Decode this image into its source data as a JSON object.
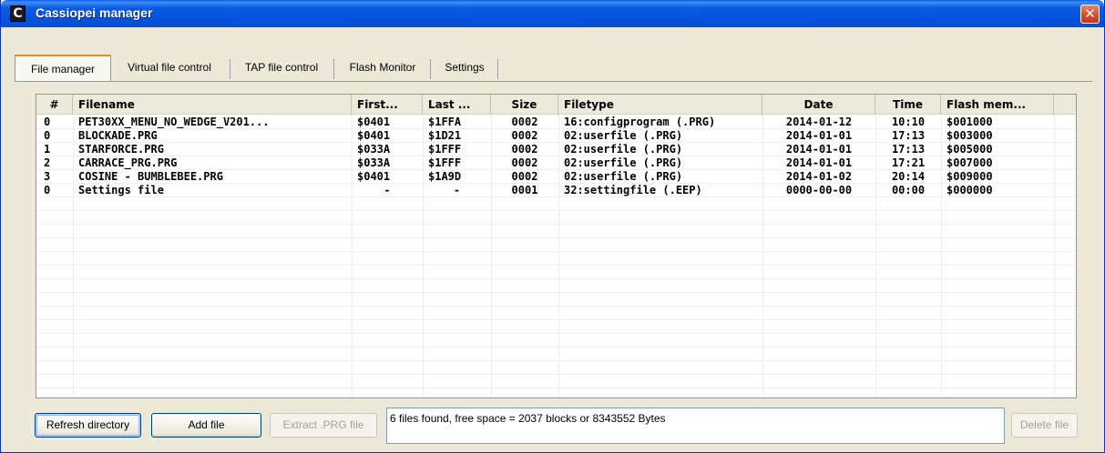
{
  "window": {
    "title": "Cassiopei manager",
    "icon_glyph": "C"
  },
  "tabs": [
    {
      "label": "File manager",
      "active": true
    },
    {
      "label": "Virtual file control",
      "active": false
    },
    {
      "label": "TAP file control",
      "active": false
    },
    {
      "label": "Flash Monitor",
      "active": false
    },
    {
      "label": "Settings",
      "active": false
    }
  ],
  "table": {
    "columns": [
      "#",
      "Filename",
      "First...",
      "Last ...",
      "Size",
      "Filetype",
      "Date",
      "Time",
      "Flash mem..."
    ],
    "rows": [
      [
        "0",
        "PET30XX_MENU_NO_WEDGE_V201...",
        "$0401",
        "$1FFA",
        "0002",
        "16:configprogram (.PRG)",
        "2014-01-12",
        "10:10",
        "$001000"
      ],
      [
        "0",
        "BLOCKADE.PRG",
        "$0401",
        "$1D21",
        "0002",
        "02:userfile (.PRG)",
        "2014-01-01",
        "17:13",
        "$003000"
      ],
      [
        "1",
        "STARFORCE.PRG",
        "$033A",
        "$1FFF",
        "0002",
        "02:userfile (.PRG)",
        "2014-01-01",
        "17:13",
        "$005000"
      ],
      [
        "2",
        "CARRACE_PRG.PRG",
        "$033A",
        "$1FFF",
        "0002",
        "02:userfile (.PRG)",
        "2014-01-01",
        "17:21",
        "$007000"
      ],
      [
        "3",
        "COSINE - BUMBLEBEE.PRG",
        "$0401",
        "$1A9D",
        "0002",
        "02:userfile (.PRG)",
        "2014-01-02",
        "20:14",
        "$009000"
      ],
      [
        "0",
        "Settings file",
        "-",
        "-",
        "0001",
        "32:settingfile (.EEP)",
        "0000-00-00",
        "00:00",
        "$000000"
      ]
    ]
  },
  "buttons": {
    "refresh": "Refresh directory",
    "add": "Add file",
    "extract": "Extract .PRG file",
    "delete": "Delete file"
  },
  "status": "6 files found, free space = 2037 blocks or 8343552 Bytes"
}
